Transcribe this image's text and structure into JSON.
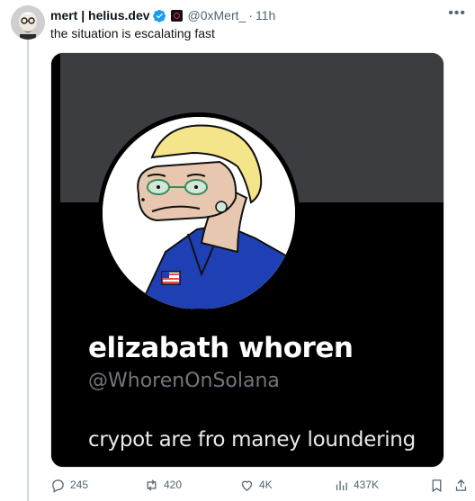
{
  "author": {
    "display_name": "mert | helius.dev",
    "handle": "@0xMert_",
    "separator": "·",
    "time": "11h",
    "verified": true,
    "avatar_icon": "avatar-glasses-beard"
  },
  "tweet": {
    "text": "the situation is escalating fast"
  },
  "media": {
    "profile_name": "elizabath whoren",
    "profile_handle": "@WhorenOnSolana",
    "profile_bio": "crypot are fro maney loundering"
  },
  "actions": {
    "replies": "245",
    "retweets": "420",
    "likes": "4K",
    "views": "437K"
  },
  "colors": {
    "verified": "#1d9bf0",
    "muted": "#536471",
    "banner": "#3b3d40",
    "media_bg": "#000000",
    "jacket": "#1f3fb5",
    "hair": "#f4e58a"
  }
}
